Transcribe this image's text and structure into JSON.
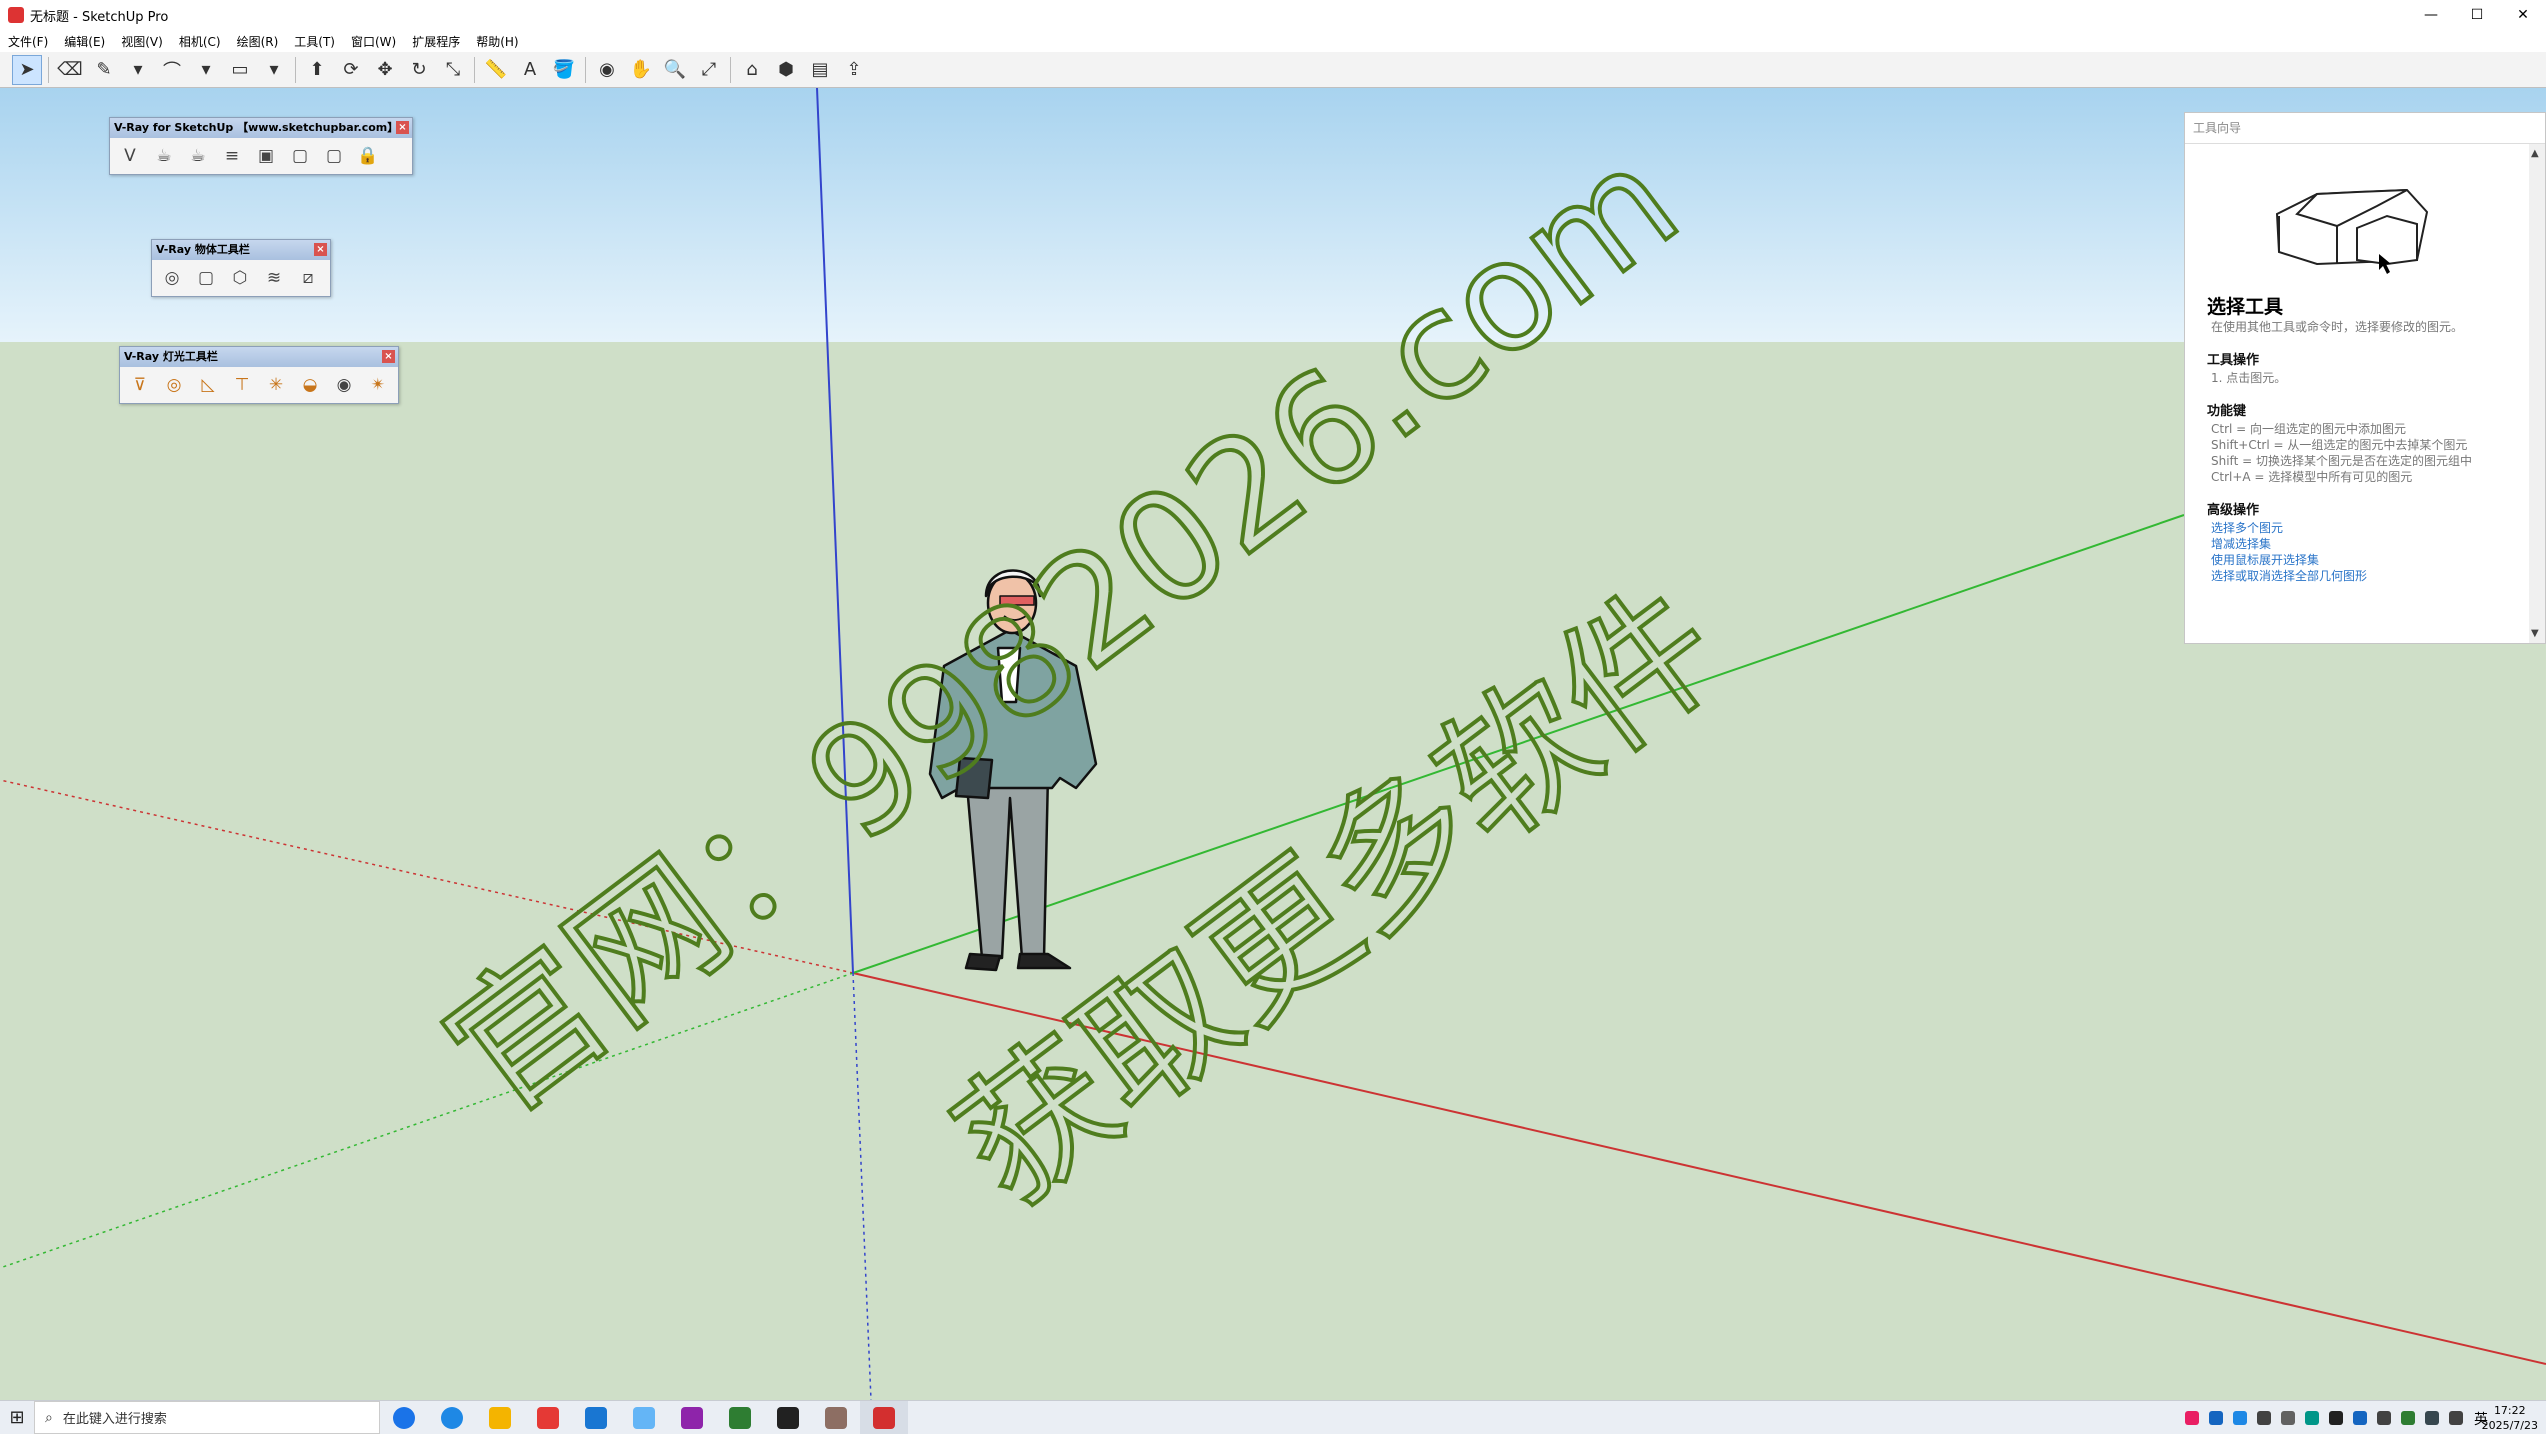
{
  "window": {
    "title": "无标题 - SketchUp Pro",
    "minimize": "—",
    "maximize": "☐",
    "close": "✕"
  },
  "menu": [
    "文件(F)",
    "编辑(E)",
    "视图(V)",
    "相机(C)",
    "绘图(R)",
    "工具(T)",
    "窗口(W)",
    "扩展程序",
    "帮助(H)"
  ],
  "toolbar": {
    "tools": [
      "select-icon",
      "eraser-icon",
      "pencil-icon",
      "dropdown-icon",
      "arc-icon",
      "dropdown-icon",
      "rectangle-icon",
      "dropdown-icon",
      "push-pull-icon",
      "offset-icon",
      "move-icon",
      "rotate-icon",
      "scale-icon",
      "tape-measure-icon",
      "text-icon",
      "paint-bucket-icon",
      "orbit-icon",
      "pan-icon",
      "zoom-icon",
      "zoom-extents-icon",
      "warehouse-icon",
      "extension-warehouse-icon",
      "layout-icon",
      "send-to-layout-icon"
    ],
    "glyphs": [
      "➤",
      "⌫",
      "✎",
      "▾",
      "⌒",
      "▾",
      "▭",
      "▾",
      "⬆",
      "⟳",
      "✥",
      "↻",
      "⤡",
      "📏",
      "A",
      "🪣",
      "◉",
      "✋",
      "🔍",
      "⤢",
      "⌂",
      "⬢",
      "▤",
      "⇪"
    ]
  },
  "vray_main": {
    "title": "V-Ray for SketchUp 【www.sketchupbar.com】",
    "icons": [
      "V",
      "☕",
      "☕",
      "≡",
      "▣",
      "▢",
      "▢",
      "🔒"
    ]
  },
  "vray_object": {
    "title": "V-Ray 物体工具栏",
    "icons": [
      "◎",
      "▢",
      "⬡",
      "≋",
      "⧄"
    ]
  },
  "vray_light": {
    "title": "V-Ray 灯光工具栏",
    "icons": [
      "⊽",
      "◎",
      "◺",
      "⊤",
      "✳",
      "◒",
      "◉",
      "✴"
    ]
  },
  "instructor": {
    "header": "工具向导",
    "title": "选择工具",
    "subtitle": "在使用其他工具或命令时，选择要修改的图元。",
    "ops_heading": "工具操作",
    "ops_item": "1.    点击图元。",
    "keys_heading": "功能键",
    "keys": [
      "Ctrl = 向一组选定的图元中添加图元",
      "Shift+Ctrl = 从一组选定的图元中去掉某个图元",
      "Shift = 切换选择某个图元是否在选定的图元组中",
      "Ctrl+A = 选择模型中所有可见的图元"
    ],
    "advanced_heading": "高级操作",
    "advanced_links": [
      "选择多个图元",
      "增减选择集",
      "使用鼠标展开选择集",
      "选择或取消选择全部几何图形"
    ]
  },
  "watermark": {
    "line1": "官网：9982026.com",
    "line2": "获取更多软件"
  },
  "taskbar": {
    "search_placeholder": "在此键入进行搜索",
    "apps": [
      "#1a73e8",
      "#1e88e5",
      "#f4b400",
      "#e53935",
      "#1976d2",
      "#64b5f6",
      "#8e24aa",
      "#2e7d32",
      "#212121",
      "#8d6e63",
      "#d32f2f"
    ],
    "tray_colors": [
      "#e91e63",
      "#1565c0",
      "#1e88e5",
      "#424242",
      "#616161",
      "#009688",
      "#212121",
      "#1565c0",
      "#424242",
      "#2e7d32",
      "#37474f",
      "#424242",
      "#1565c0",
      "#424242"
    ],
    "ime": "英",
    "time": "17:22",
    "date": "2025/7/23"
  }
}
